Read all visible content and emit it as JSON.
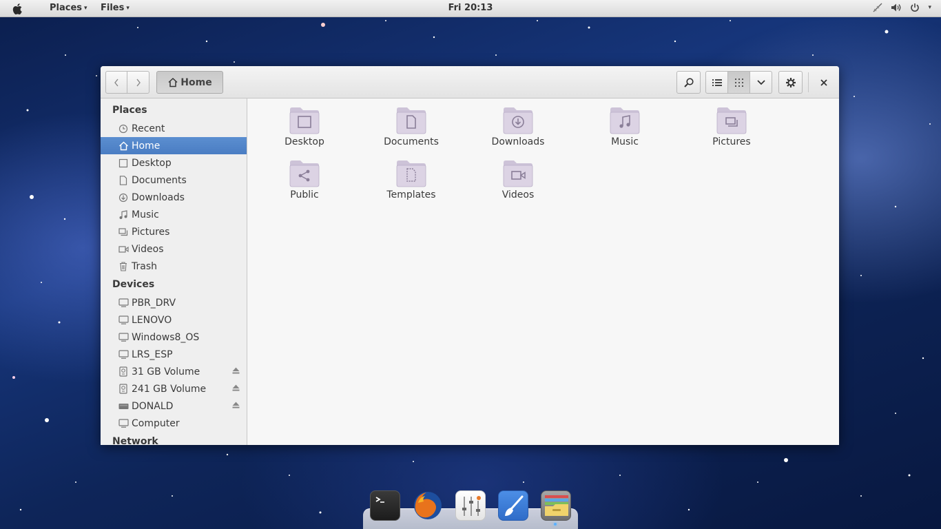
{
  "top_panel": {
    "menus": [
      {
        "label": "Places",
        "caret": "▾"
      },
      {
        "label": "Files",
        "caret": "▾"
      }
    ],
    "clock": "Fri 20:13",
    "tray_icons": [
      "network-disconnected-icon",
      "volume-icon",
      "power-icon"
    ]
  },
  "window": {
    "nav": {
      "back_icon": "chevron-left-icon",
      "forward_icon": "chevron-right-icon"
    },
    "path_button": {
      "icon": "home-icon",
      "label": "Home"
    },
    "toolbar_icons": [
      "search-icon",
      "list-view-icon",
      "grid-view-icon",
      "view-options-icon",
      "gear-icon",
      "close-icon"
    ],
    "sidebar": {
      "places_title": "Places",
      "places": [
        {
          "label": "Recent",
          "icon": "clock-icon"
        },
        {
          "label": "Home",
          "icon": "home-icon",
          "active": true
        },
        {
          "label": "Desktop",
          "icon": "desktop-icon"
        },
        {
          "label": "Documents",
          "icon": "document-icon"
        },
        {
          "label": "Downloads",
          "icon": "download-icon"
        },
        {
          "label": "Music",
          "icon": "music-icon"
        },
        {
          "label": "Pictures",
          "icon": "pictures-icon"
        },
        {
          "label": "Videos",
          "icon": "video-icon"
        },
        {
          "label": "Trash",
          "icon": "trash-icon"
        }
      ],
      "devices_title": "Devices",
      "devices": [
        {
          "label": "PBR_DRV",
          "icon": "drive-icon"
        },
        {
          "label": "LENOVO",
          "icon": "drive-icon"
        },
        {
          "label": "Windows8_OS",
          "icon": "drive-icon"
        },
        {
          "label": "LRS_ESP",
          "icon": "drive-icon"
        },
        {
          "label": "31 GB Volume",
          "icon": "removable-drive-icon",
          "eject": true
        },
        {
          "label": "241 GB Volume",
          "icon": "removable-drive-icon",
          "eject": true
        },
        {
          "label": "DONALD",
          "icon": "usb-drive-icon",
          "eject": true
        },
        {
          "label": "Computer",
          "icon": "computer-icon"
        }
      ],
      "network_title": "Network"
    },
    "files": [
      {
        "label": "Desktop",
        "emblem": "desktop"
      },
      {
        "label": "Documents",
        "emblem": "document"
      },
      {
        "label": "Downloads",
        "emblem": "download"
      },
      {
        "label": "Music",
        "emblem": "music"
      },
      {
        "label": "Pictures",
        "emblem": "pictures"
      },
      {
        "label": "Public",
        "emblem": "share"
      },
      {
        "label": "Templates",
        "emblem": "template"
      },
      {
        "label": "Videos",
        "emblem": "video"
      }
    ]
  },
  "dock": {
    "apps": [
      "terminal-icon",
      "firefox-icon",
      "settings-mixer-icon",
      "paint-brush-icon",
      "files-icon"
    ]
  },
  "colors": {
    "selection": "#4f83c8",
    "folder": "#d8cfe0",
    "panel": "#e6e6e6"
  }
}
